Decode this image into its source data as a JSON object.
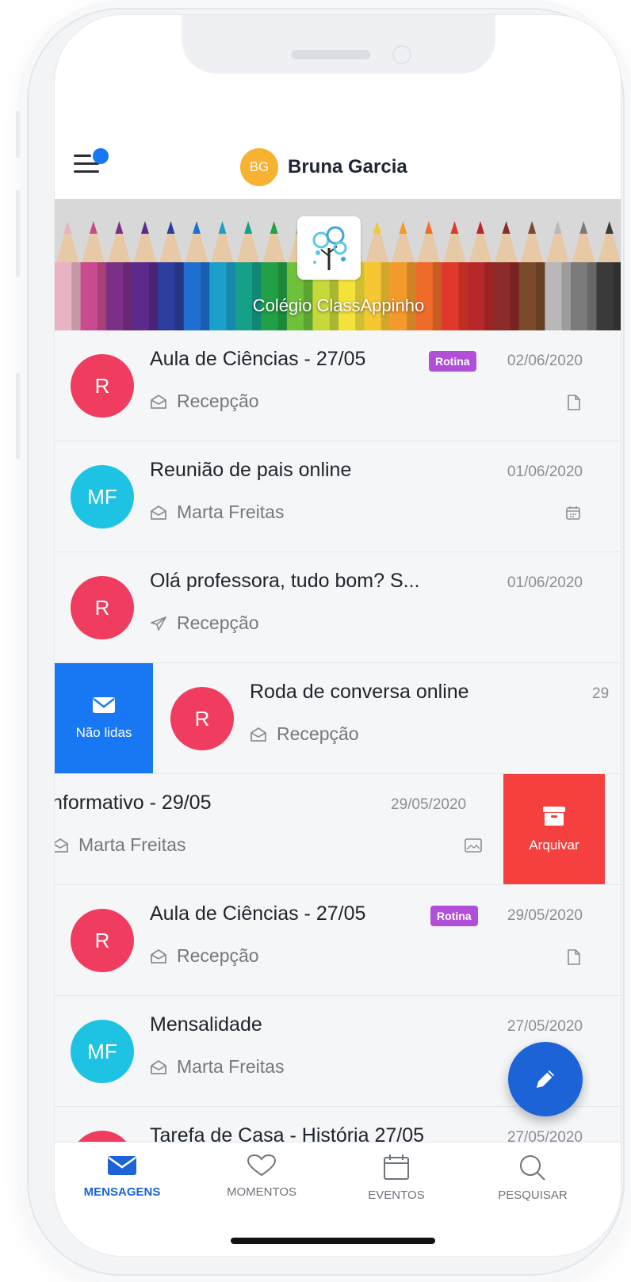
{
  "header": {
    "user_initials": "BG",
    "user_name": "Bruna Garcia",
    "school_name": "Colégio ClassAppinho"
  },
  "messages": [
    {
      "avatar": "R",
      "avatar_color": "#ef3c5f",
      "subject": "Aula de Ciências - 27/05",
      "tag": "Rotina",
      "date": "02/06/2020",
      "sender": "Recepção",
      "sender_icon": "envelope-open-icon",
      "attachment_icon": "file-icon"
    },
    {
      "avatar": "MF",
      "avatar_color": "#1ec3e3",
      "subject": "Reunião de pais online",
      "tag": "",
      "date": "01/06/2020",
      "sender": "Marta Freitas",
      "sender_icon": "envelope-open-icon",
      "attachment_icon": "calendar-icon"
    },
    {
      "avatar": "R",
      "avatar_color": "#ef3c5f",
      "subject": "Olá professora, tudo bom? S...",
      "tag": "",
      "date": "01/06/2020",
      "sender": "Recepção",
      "sender_icon": "paper-plane-icon",
      "attachment_icon": ""
    },
    {
      "avatar": "R",
      "avatar_color": "#ef3c5f",
      "subject": "Roda de conversa online",
      "tag": "",
      "date": "29",
      "sender": "Recepção",
      "sender_icon": "envelope-open-icon",
      "attachment_icon": "",
      "swipe_action": "Não lidas"
    },
    {
      "avatar": "",
      "avatar_color": "",
      "subject": "nformativo - 29/05",
      "tag": "",
      "date": "29/05/2020",
      "sender": "Marta Freitas",
      "sender_icon": "envelope-open-icon",
      "attachment_icon": "image-icon",
      "swipe_action": "Arquivar"
    },
    {
      "avatar": "R",
      "avatar_color": "#ef3c5f",
      "subject": "Aula de Ciências - 27/05",
      "tag": "Rotina",
      "date": "29/05/2020",
      "sender": "Recepção",
      "sender_icon": "envelope-open-icon",
      "attachment_icon": "file-icon"
    },
    {
      "avatar": "MF",
      "avatar_color": "#1ec3e3",
      "subject": "Mensalidade",
      "tag": "",
      "date": "27/05/2020",
      "sender": "Marta Freitas",
      "sender_icon": "envelope-open-icon",
      "attachment_icon": ""
    },
    {
      "avatar": "",
      "avatar_color": "#ef3c5f",
      "subject": "Tarefa de Casa - História 27/05",
      "tag": "",
      "date": "27/05/2020",
      "sender": "",
      "sender_icon": "",
      "attachment_icon": ""
    }
  ],
  "tabs": [
    {
      "label": "MENSAGENS",
      "icon": "envelope-icon",
      "active": true
    },
    {
      "label": "MOMENTOS",
      "icon": "heart-icon",
      "active": false
    },
    {
      "label": "EVENTOS",
      "icon": "calendar-icon",
      "active": false
    },
    {
      "label": "PESQUISAR",
      "icon": "search-icon",
      "active": false
    }
  ],
  "colors": {
    "accent": "#1b63d6",
    "unread_action": "#1877f2",
    "archive_action": "#f5403f",
    "tag": "#b24fd8"
  }
}
